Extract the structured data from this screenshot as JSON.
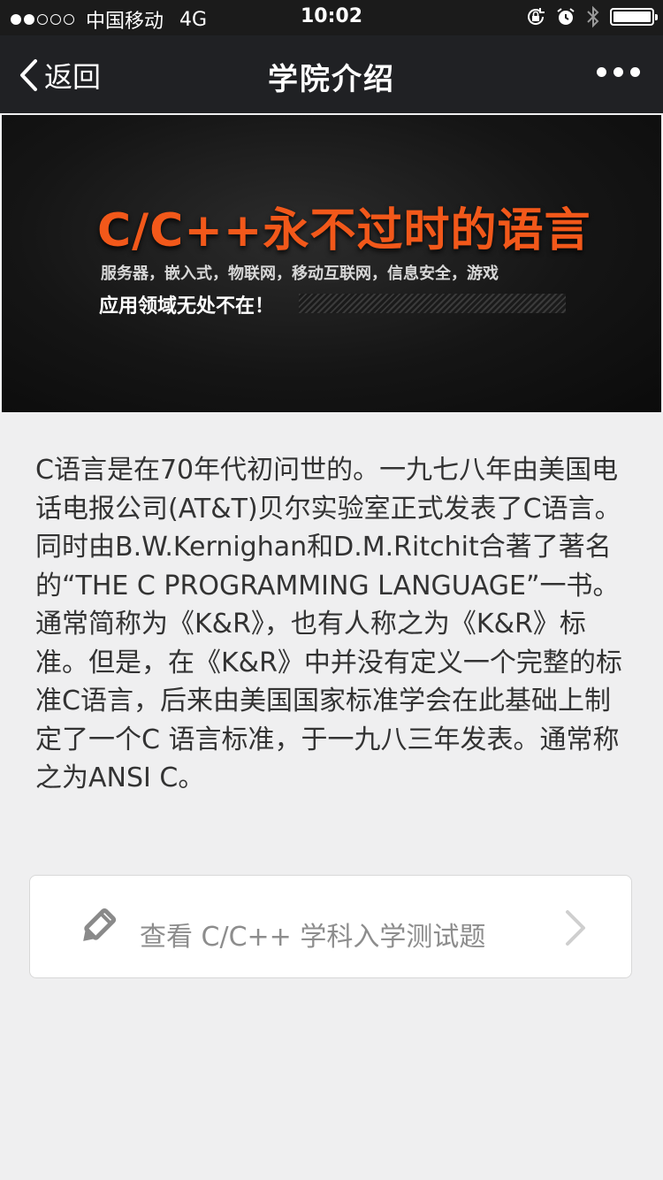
{
  "status_bar": {
    "carrier": "中国移动",
    "network": "4G",
    "time": "10:02",
    "signal_strength": 2,
    "signal_max": 5
  },
  "nav": {
    "back_label": "返回",
    "title": "学院介绍"
  },
  "banner": {
    "headline": "C/C++永不过时的语言",
    "subline": "服务器，嵌入式，物联网，移动互联网，信息安全，游戏",
    "tagline": "应用领域无处不在！"
  },
  "intro": {
    "text": "C语言是在70年代初问世的。一九七八年由美国电话电报公司(AT&T)贝尔实验室正式发表了C语言。同时由B.W.Kernighan和D.M.Ritchit合著了著名的“THE C PROGRAMMING LANGUAGE”一书。通常简称为《K&R》，也有人称之为《K&R》标准。但是，在《K&R》中并没有定义一个完整的标准C语言，后来由美国国家标准学会在此基础上制定了一个C 语言标准，于一九八三年发表。通常称之为ANSI C。"
  },
  "quiz_card": {
    "label": "查看 C/C++ 学科入学测试题",
    "icon": "pencil-icon"
  },
  "colors": {
    "nav_bg": "#202124",
    "banner_accent": "#f2581a",
    "page_bg": "#efeff0",
    "text": "#333333"
  }
}
